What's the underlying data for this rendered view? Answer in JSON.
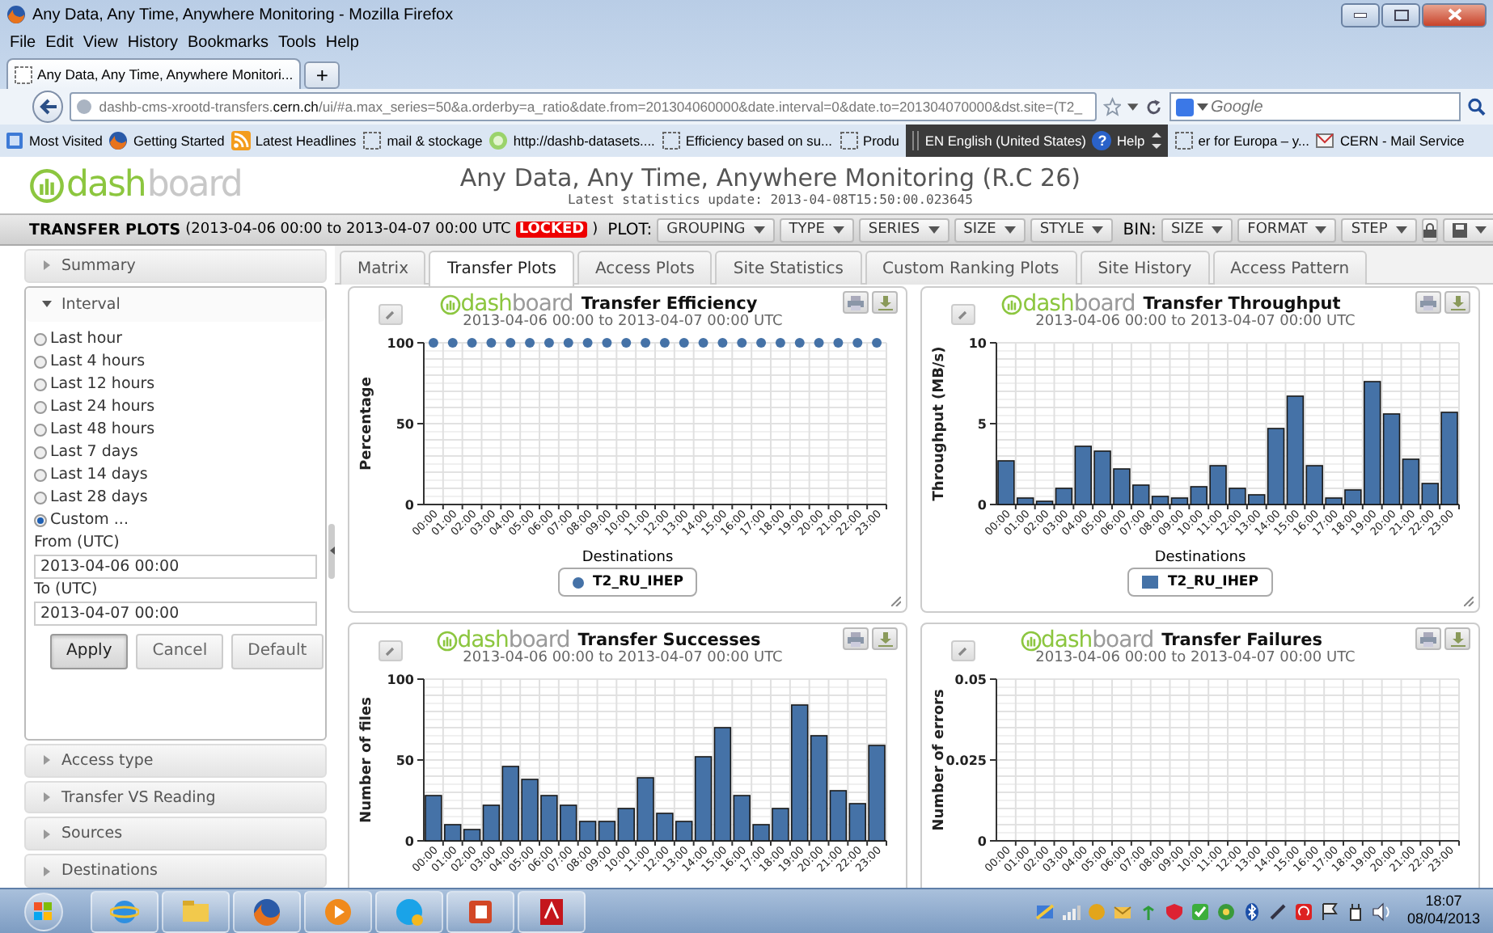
{
  "browser": {
    "title": "Any Data, Any Time, Anywhere Monitoring - Mozilla Firefox",
    "menu": [
      "File",
      "Edit",
      "View",
      "History",
      "Bookmarks",
      "Tools",
      "Help"
    ],
    "tab": "Any Data, Any Time, Anywhere Monitori...",
    "new_tab": "+",
    "url": "dashb-cms-xrootd-transfers.**cern.ch**/ui/#a.max_series=50&a.orderby=a_ratio&date.from=201304060000&date.interval=0&date.to=201304070000&dst.site=(T2_",
    "search": {
      "placeholder": "Google"
    },
    "bookmarks": [
      {
        "kind": "bookmark",
        "label": "Most Visited"
      },
      {
        "kind": "bookmark",
        "label": "Getting Started"
      },
      {
        "kind": "bookmark",
        "label": "Latest Headlines"
      },
      {
        "kind": "bookmark",
        "label": "mail & stockage"
      },
      {
        "kind": "bookmark",
        "label": "http://dashb-datasets...."
      },
      {
        "kind": "bookmark",
        "label": "Efficiency based on su..."
      },
      {
        "kind": "bookmark",
        "label": "Produ"
      },
      {
        "kind": "language_bar",
        "language": "EN English (United States)",
        "help_icon": "?",
        "help": "Help"
      },
      {
        "kind": "bookmark",
        "label": "er for Europa – y..."
      },
      {
        "kind": "bookmark",
        "label": "CERN - Mail Service"
      }
    ]
  },
  "dashboard": {
    "logo": {
      "part_1": "dash",
      "part_2": "board"
    },
    "title": "Any Data, Any Time, Anywhere Monitoring (R.C 26)",
    "update": "Latest statistics update: 2013-04-08T15:50:00.023645"
  },
  "toolbar": {
    "title": "TRANSFER PLOTS",
    "range": "(2013-04-06 00:00 to 2013-04-07 00:00 UTC",
    "badge": "LOCKED",
    "range_end": ")",
    "groups": [
      {
        "label": "PLOT:",
        "menus": [
          "GROUPING",
          "TYPE",
          "SERIES",
          "SIZE",
          "STYLE"
        ]
      },
      {
        "label": "BIN:",
        "menus": [
          "SIZE",
          "FORMAT",
          "STEP"
        ]
      }
    ]
  },
  "sidebar": {
    "sections": [
      {
        "label": "Summary",
        "expanded": false
      },
      {
        "label": "Interval",
        "expanded": true,
        "options": [
          {
            "label": "Last hour",
            "selected": false
          },
          {
            "label": "Last 4 hours",
            "selected": false
          },
          {
            "label": "Last 12 hours",
            "selected": false
          },
          {
            "label": "Last 24 hours",
            "selected": false
          },
          {
            "label": "Last 48 hours",
            "selected": false
          },
          {
            "label": "Last 7 days",
            "selected": false
          },
          {
            "label": "Last 14 days",
            "selected": false
          },
          {
            "label": "Last 28 days",
            "selected": false
          },
          {
            "label": "Custom ...",
            "selected": true
          }
        ],
        "from_label": "From (UTC)",
        "from": "2013-04-06 00:00",
        "to_label": "To (UTC)",
        "to": "2013-04-07 00:00",
        "buttons": [
          {
            "label": "Apply",
            "focused": true
          },
          {
            "label": "Cancel",
            "focused": false
          },
          {
            "label": "Default",
            "focused": false
          }
        ]
      },
      {
        "label": "Access type",
        "expanded": false
      },
      {
        "label": "Transfer VS Reading",
        "expanded": false
      },
      {
        "label": "Sources",
        "expanded": false
      },
      {
        "label": "Destinations",
        "expanded": false
      }
    ]
  },
  "tabs": [
    {
      "label": "Matrix",
      "selected": false
    },
    {
      "label": "Transfer Plots",
      "selected": true
    },
    {
      "label": "Access Plots",
      "selected": false
    },
    {
      "label": "Site Statistics",
      "selected": false
    },
    {
      "label": "Custom Ranking Plots",
      "selected": false
    },
    {
      "label": "Site History",
      "selected": false
    },
    {
      "label": "Access Pattern",
      "selected": false
    }
  ],
  "charts": [
    {
      "logo": {
        "part_1": "dash",
        "part_2": "board"
      },
      "title": "Transfer Efficiency",
      "subtitle": "2013-04-06 00:00 to 2013-04-07 00:00 UTC",
      "legend_title": "Destinations",
      "chart_data": {
        "type": "scatter",
        "ylabel": "Percentage",
        "categories": [
          "00:00",
          "01:00",
          "02:00",
          "03:00",
          "04:00",
          "05:00",
          "06:00",
          "07:00",
          "08:00",
          "09:00",
          "10:00",
          "11:00",
          "12:00",
          "13:00",
          "14:00",
          "15:00",
          "16:00",
          "17:00",
          "18:00",
          "19:00",
          "20:00",
          "21:00",
          "22:00",
          "23:00"
        ],
        "ylim": [
          0,
          100
        ],
        "yticks": [
          0,
          50,
          100
        ],
        "grid": true,
        "series": [
          {
            "name": "T2_RU_IHEP",
            "color": "#4572a7",
            "values": [
              100,
              100,
              100,
              100,
              100,
              100,
              100,
              100,
              100,
              100,
              100,
              100,
              100,
              100,
              100,
              100,
              100,
              100,
              100,
              100,
              100,
              100,
              100,
              100
            ]
          }
        ]
      }
    },
    {
      "logo": {
        "part_1": "dash",
        "part_2": "board"
      },
      "title": "Transfer Throughput",
      "subtitle": "2013-04-06 00:00 to 2013-04-07 00:00 UTC",
      "legend_title": "Destinations",
      "chart_data": {
        "type": "bar",
        "ylabel": "Throughput (MB/s)",
        "categories": [
          "00:00",
          "01:00",
          "02:00",
          "03:00",
          "04:00",
          "05:00",
          "06:00",
          "07:00",
          "08:00",
          "09:00",
          "10:00",
          "11:00",
          "12:00",
          "13:00",
          "14:00",
          "15:00",
          "16:00",
          "17:00",
          "18:00",
          "19:00",
          "20:00",
          "21:00",
          "22:00",
          "23:00"
        ],
        "ylim": [
          0,
          10
        ],
        "yticks": [
          0,
          5,
          10
        ],
        "grid": true,
        "series": [
          {
            "name": "T2_RU_IHEP",
            "color": "#4572a7",
            "values": [
              2.7,
              0.4,
              0.2,
              1.0,
              3.6,
              3.3,
              2.2,
              1.2,
              0.5,
              0.4,
              1.1,
              2.4,
              1.0,
              0.6,
              4.7,
              6.7,
              2.4,
              0.4,
              0.9,
              7.6,
              5.6,
              2.8,
              1.3,
              5.7
            ]
          }
        ]
      }
    },
    {
      "logo": {
        "part_1": "dash",
        "part_2": "board"
      },
      "title": "Transfer Successes",
      "subtitle": "2013-04-06 00:00 to 2013-04-07 00:00 UTC",
      "chart_data": {
        "type": "bar",
        "ylabel": "Number of files",
        "categories": [
          "00:00",
          "01:00",
          "02:00",
          "03:00",
          "04:00",
          "05:00",
          "06:00",
          "07:00",
          "08:00",
          "09:00",
          "10:00",
          "11:00",
          "12:00",
          "13:00",
          "14:00",
          "15:00",
          "16:00",
          "17:00",
          "18:00",
          "19:00",
          "20:00",
          "21:00",
          "22:00",
          "23:00"
        ],
        "ylim": [
          0,
          100
        ],
        "yticks": [
          0,
          50,
          100
        ],
        "grid": true,
        "series": [
          {
            "color": "#4572a7",
            "values": [
              28,
              10,
              7,
              22,
              46,
              38,
              28,
              22,
              12,
              12,
              20,
              39,
              17,
              12,
              52,
              70,
              28,
              10,
              20,
              84,
              65,
              31,
              23,
              59
            ]
          }
        ]
      }
    },
    {
      "logo": {
        "part_1": "dash",
        "part_2": "board"
      },
      "title": "Transfer Failures",
      "subtitle": "2013-04-06 00:00 to 2013-04-07 00:00 UTC",
      "chart_data": {
        "type": "bar",
        "ylabel": "Number of errors",
        "categories": [
          "00:00",
          "01:00",
          "02:00",
          "03:00",
          "04:00",
          "05:00",
          "06:00",
          "07:00",
          "08:00",
          "09:00",
          "10:00",
          "11:00",
          "12:00",
          "13:00",
          "14:00",
          "15:00",
          "16:00",
          "17:00",
          "18:00",
          "19:00",
          "20:00",
          "21:00",
          "22:00",
          "23:00"
        ],
        "ylim": [
          0,
          0.05
        ],
        "yticks": [
          {
            "value": 0,
            "label": "0"
          },
          {
            "value": 0.025,
            "label": "0.025"
          },
          {
            "value": 0.05,
            "label": "0.05"
          }
        ],
        "grid": true
      }
    }
  ],
  "taskbar": {
    "time": "18:07",
    "date": "08/04/2013"
  }
}
